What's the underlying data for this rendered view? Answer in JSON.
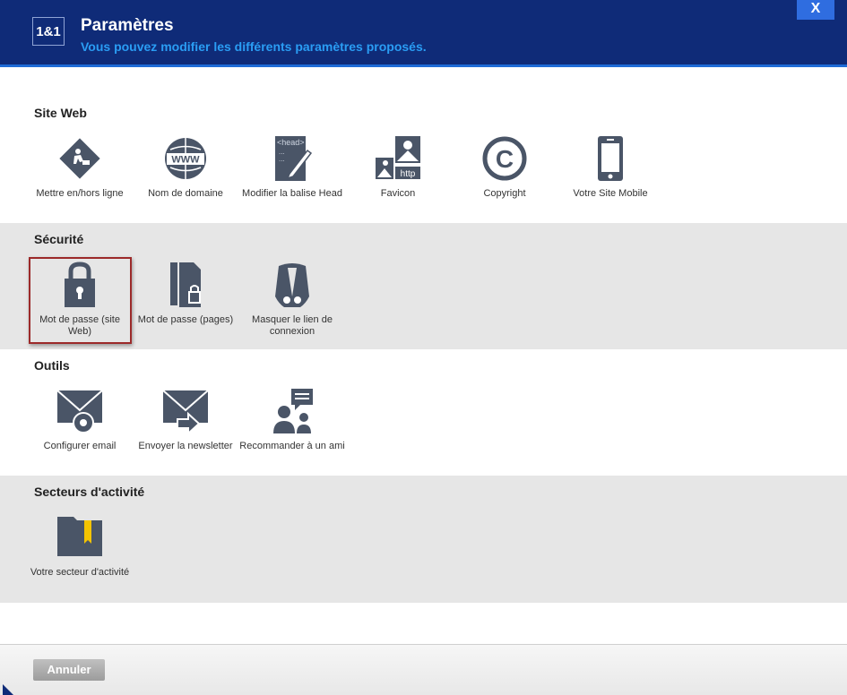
{
  "header": {
    "logo": "1&1",
    "title": "Paramètres",
    "subtitle": "Vous pouvez modifier les différents paramètres proposés.",
    "close_label": "X"
  },
  "sections": [
    {
      "title": "Site Web",
      "items": [
        {
          "label": "Mettre en/hors ligne",
          "icon": "construction-sign-icon"
        },
        {
          "label": "Nom de domaine",
          "icon": "www-globe-icon"
        },
        {
          "label": "Modifier la balise Head",
          "icon": "head-tag-edit-icon"
        },
        {
          "label": "Favicon",
          "icon": "favicon-image-icon"
        },
        {
          "label": "Copyright",
          "icon": "copyright-icon"
        },
        {
          "label": "Votre Site Mobile",
          "icon": "mobile-phone-icon"
        }
      ]
    },
    {
      "title": "Sécurité",
      "items": [
        {
          "label": "Mot de passe (site Web)",
          "icon": "padlock-icon",
          "selected": true
        },
        {
          "label": "Mot de passe (pages)",
          "icon": "pages-lock-icon"
        },
        {
          "label": "Masquer le lien de connexion",
          "icon": "masked-agent-icon"
        }
      ]
    },
    {
      "title": "Outils",
      "items": [
        {
          "label": "Configurer email",
          "icon": "email-settings-icon"
        },
        {
          "label": "Envoyer la newsletter",
          "icon": "email-send-icon"
        },
        {
          "label": "Recommander à un ami",
          "icon": "recommend-friend-icon"
        }
      ]
    },
    {
      "title": "Secteurs d'activité",
      "items": [
        {
          "label": "Votre secteur d'activité",
          "icon": "folder-bookmark-icon"
        }
      ]
    }
  ],
  "footer": {
    "cancel_label": "Annuler"
  },
  "colors": {
    "header_bg": "#0f2b78",
    "subtitle": "#2a9df4",
    "icon": "#4a5567",
    "selection_border": "#9c2a2a",
    "section_gray": "#e6e6e6"
  }
}
